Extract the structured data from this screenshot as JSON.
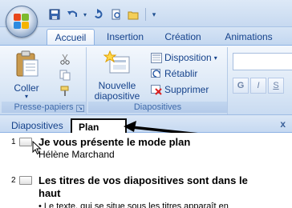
{
  "quick_access": {
    "icons": [
      "save-icon",
      "undo-icon",
      "redo-icon",
      "print-preview-icon",
      "open-icon",
      "dropdown-icon"
    ]
  },
  "tabs": [
    {
      "label": "Accueil",
      "active": true
    },
    {
      "label": "Insertion",
      "active": false
    },
    {
      "label": "Création",
      "active": false
    },
    {
      "label": "Animations",
      "active": false
    }
  ],
  "ribbon": {
    "clipboard": {
      "title": "Presse-papiers",
      "paste_label": "Coller"
    },
    "slides": {
      "title": "Diapositives",
      "new_slide_line1": "Nouvelle",
      "new_slide_line2": "diapositive",
      "layout_label": "Disposition",
      "reset_label": "Rétablir",
      "delete_label": "Supprimer"
    },
    "font": {
      "bold_label": "G",
      "italic_label": "I",
      "underline_label": "S"
    }
  },
  "pane": {
    "tab_slides": "Diapositives",
    "tab_outline": "Plan",
    "close": "x"
  },
  "outline": {
    "slides": [
      {
        "number": "1",
        "title": "Je vous présente le mode plan",
        "subtitle": "Hélène Marchand"
      },
      {
        "number": "2",
        "title_line1": "Les titres de vos diapositives sont dans le",
        "title_line2": "haut",
        "bullet": "• Le texte, qui se situe sous les titres apparaît en"
      }
    ]
  },
  "colors": {
    "ribbon_text": "#15428b",
    "arrow": "#000000"
  }
}
